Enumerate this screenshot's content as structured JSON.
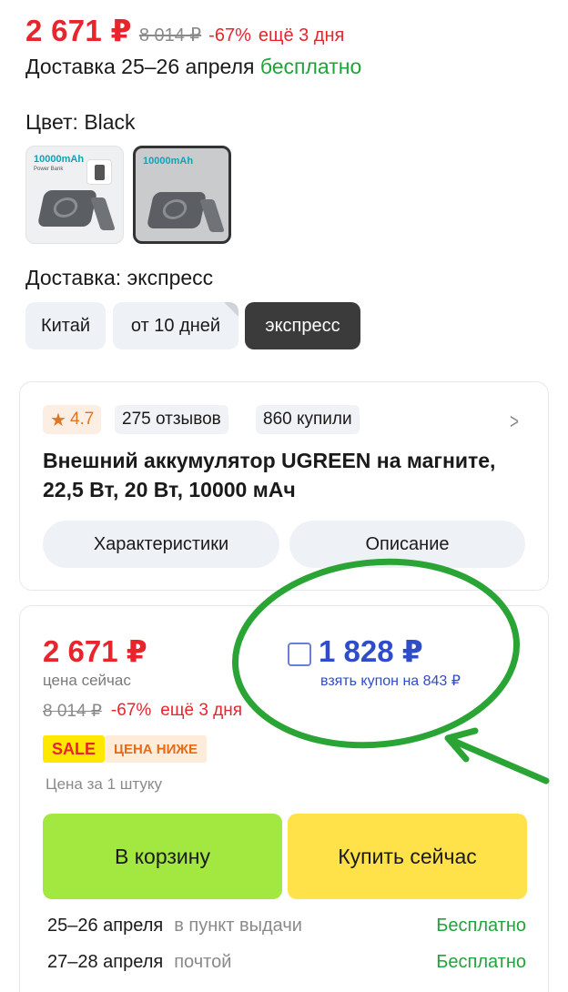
{
  "top": {
    "price": "2 671 ₽",
    "old_price": "8 014 ₽",
    "discount": "-67%",
    "days_left": "ещё 3 дня",
    "delivery_prefix": "Доставка 25–26 апреля",
    "delivery_free": "бесплатно"
  },
  "color": {
    "label": "Цвет: Black",
    "thumbnails": [
      {
        "caption": "10000mAh",
        "subtitle": "Power Bank",
        "selected": false
      },
      {
        "caption": "10000mAh",
        "subtitle": "",
        "selected": true
      }
    ]
  },
  "shipping": {
    "label": "Доставка: экспресс",
    "options": [
      "Китай",
      "от 10 дней",
      "экспресс"
    ],
    "selected": "экспресс"
  },
  "product_card": {
    "rating": "4.7",
    "reviews": "275 отзывов",
    "bought": "860 купили",
    "title": "Внешний аккумулятор UGREEN на магните, 22,5 Вт, 20 Вт, 10000 мАч",
    "tab_specs": "Характеристики",
    "tab_description": "Описание"
  },
  "buy_card": {
    "price": "2 671 ₽",
    "price_note": "цена сейчас",
    "old_price": "8 014 ₽",
    "discount": "-67%",
    "days_left": "ещё 3 дня",
    "coupon_price": "1 828 ₽",
    "coupon_take": "взять купон на 843 ₽",
    "badge_sale": "SALE",
    "badge_lower": "ЦЕНА НИЖЕ",
    "per_unit": "Цена за 1 штуку",
    "btn_cart": "В корзину",
    "btn_buy": "Купить сейчас",
    "delivery": [
      {
        "date": "25–26 апреля",
        "method": "в пункт выдачи",
        "fee": "Бесплатно"
      },
      {
        "date": "27–28 апреля",
        "method": "почтой",
        "fee": "Бесплатно"
      }
    ]
  },
  "colors": {
    "price_red": "#e8242d",
    "free_green": "#1fa33a",
    "coupon_blue": "#2f4cc9",
    "cart_green": "#a3e841",
    "buy_yellow": "#ffe24a",
    "annotation_green": "#2aa535"
  }
}
